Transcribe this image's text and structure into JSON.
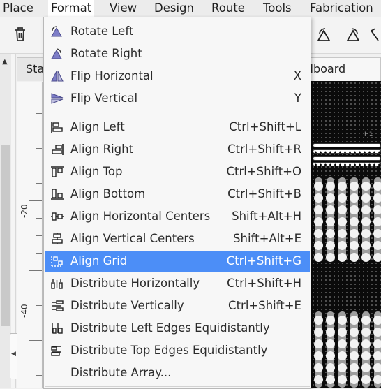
{
  "menubar": [
    "Place",
    "Format",
    "View",
    "Design",
    "Route",
    "Tools",
    "Fabrication"
  ],
  "tabs": {
    "left": "Sta",
    "right": "adboard"
  },
  "ruler": [
    "-20",
    "-40"
  ],
  "canvas": {
    "part_label": "H1"
  },
  "menu": {
    "rotate_left": {
      "label": "Rotate Left",
      "shortcut": ""
    },
    "rotate_right": {
      "label": "Rotate Right",
      "shortcut": ""
    },
    "flip_horizontal": {
      "label": "Flip Horizontal",
      "shortcut": "X"
    },
    "flip_vertical": {
      "label": "Flip Vertical",
      "shortcut": "Y"
    },
    "align_left": {
      "label": "Align Left",
      "shortcut": "Ctrl+Shift+L"
    },
    "align_right": {
      "label": "Align Right",
      "shortcut": "Ctrl+Shift+R"
    },
    "align_top": {
      "label": "Align Top",
      "shortcut": "Ctrl+Shift+O"
    },
    "align_bottom": {
      "label": "Align Bottom",
      "shortcut": "Ctrl+Shift+B"
    },
    "align_hcenters": {
      "label": "Align Horizontal Centers",
      "shortcut": "Shift+Alt+H"
    },
    "align_vcenters": {
      "label": "Align Vertical Centers",
      "shortcut": "Shift+Alt+E"
    },
    "align_grid": {
      "label": "Align Grid",
      "shortcut": "Ctrl+Shift+G"
    },
    "dist_h": {
      "label": "Distribute Horizontally",
      "shortcut": "Ctrl+Shift+H"
    },
    "dist_v": {
      "label": "Distribute Vertically",
      "shortcut": "Ctrl+Shift+E"
    },
    "dist_left": {
      "label": "Distribute Left Edges Equidistantly",
      "shortcut": ""
    },
    "dist_top": {
      "label": "Distribute Top Edges Equidistantly",
      "shortcut": ""
    },
    "dist_array": {
      "label": "Distribute Array...",
      "shortcut": ""
    }
  },
  "colors": {
    "highlight": "#4c8ef7",
    "icon_purple": "#6b6bb5"
  }
}
